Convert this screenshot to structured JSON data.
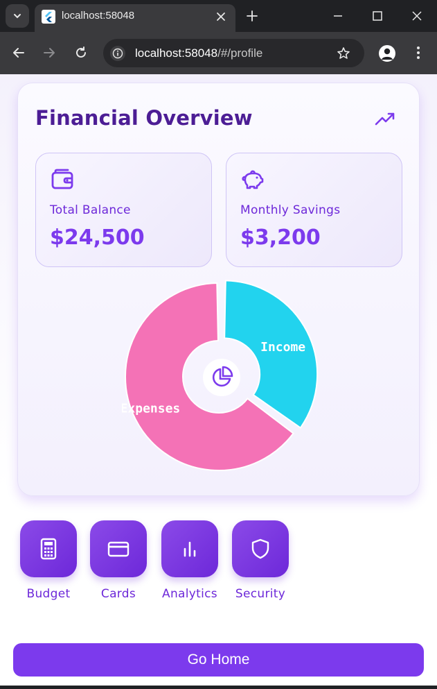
{
  "browser": {
    "tab_title": "localhost:58048",
    "url_host": "localhost:58048",
    "url_path": "/#/profile"
  },
  "overview": {
    "title": "Financial Overview",
    "stats": [
      {
        "label": "Total Balance",
        "value": "$24,500",
        "icon": "wallet-icon"
      },
      {
        "label": "Monthly Savings",
        "value": "$3,200",
        "icon": "piggy-bank-icon"
      }
    ]
  },
  "chart_data": {
    "type": "pie",
    "categories": [
      "Income",
      "Expenses"
    ],
    "values": [
      35,
      65
    ],
    "colors": [
      "#22d3ee",
      "#f472b6"
    ],
    "legend": "none",
    "center_icon": "pie-chart-icon"
  },
  "actions": [
    {
      "label": "Budget",
      "icon": "calculator-icon"
    },
    {
      "label": "Cards",
      "icon": "credit-card-icon"
    },
    {
      "label": "Analytics",
      "icon": "bar-chart-icon"
    },
    {
      "label": "Security",
      "icon": "shield-icon"
    }
  ],
  "home_button": "Go Home",
  "colors": {
    "primary": "#7c3aed",
    "title": "#4c1d95",
    "income": "#22d3ee",
    "expenses": "#f472b6"
  }
}
